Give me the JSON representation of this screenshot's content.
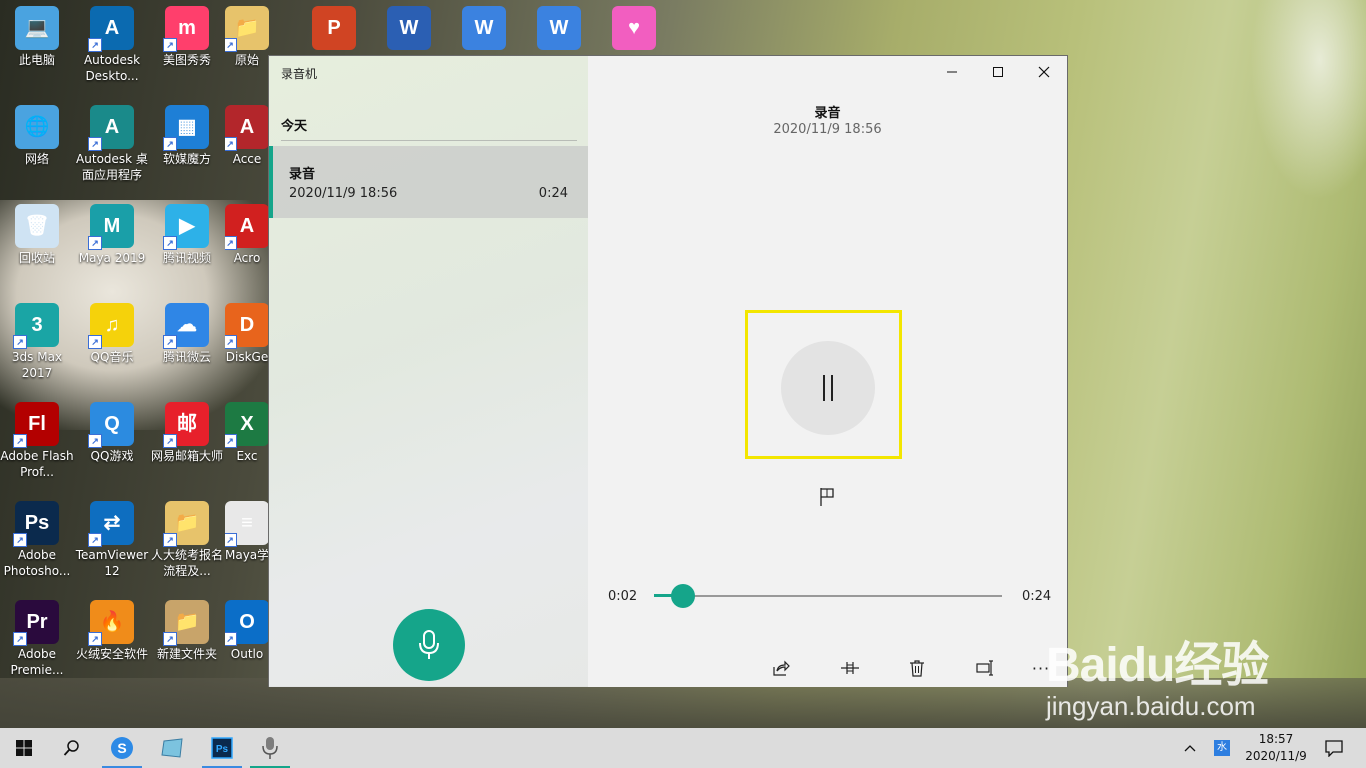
{
  "desktop": {
    "icons": [
      {
        "label": "此电脑",
        "glyph": "💻",
        "color": "#4aa3e0"
      },
      {
        "label": "Autodesk Deskto...",
        "glyph": "A",
        "color": "#0b6ab0"
      },
      {
        "label": "美图秀秀",
        "glyph": "m",
        "color": "#ff3f6c"
      },
      {
        "label": "原始",
        "glyph": "📁",
        "color": "#e7c36b"
      },
      {
        "label": "网络",
        "glyph": "🌐",
        "color": "#4aa3e0"
      },
      {
        "label": "Autodesk 桌面应用程序",
        "glyph": "A",
        "color": "#1a8a8a"
      },
      {
        "label": "软媒魔方",
        "glyph": "▦",
        "color": "#1e7fd6"
      },
      {
        "label": "Acce",
        "glyph": "A",
        "color": "#b3262b"
      },
      {
        "label": "回收站",
        "glyph": "🗑",
        "color": "#cfe3f3"
      },
      {
        "label": "Maya 2019",
        "glyph": "M",
        "color": "#1a9fa8"
      },
      {
        "label": "腾讯视频",
        "glyph": "▶",
        "color": "#2db1e8"
      },
      {
        "label": "Acro",
        "glyph": "A",
        "color": "#d1201f"
      },
      {
        "label": "3ds Max 2017",
        "glyph": "3",
        "color": "#1aa5a5"
      },
      {
        "label": "QQ音乐",
        "glyph": "♫",
        "color": "#f5d20b"
      },
      {
        "label": "腾讯微云",
        "glyph": "☁",
        "color": "#2f86e6"
      },
      {
        "label": "DiskGe",
        "glyph": "D",
        "color": "#e8641c"
      },
      {
        "label": "Adobe Flash Prof...",
        "glyph": "Fl",
        "color": "#b30000"
      },
      {
        "label": "QQ游戏",
        "glyph": "Q",
        "color": "#2c8be0"
      },
      {
        "label": "网易邮箱大师",
        "glyph": "邮",
        "color": "#e7202b"
      },
      {
        "label": "Exc",
        "glyph": "X",
        "color": "#1d7a43"
      },
      {
        "label": "Adobe Photosho...",
        "glyph": "Ps",
        "color": "#0b2a4d"
      },
      {
        "label": "TeamViewer 12",
        "glyph": "⇄",
        "color": "#0e6ec0"
      },
      {
        "label": "人大统考报名流程及...",
        "glyph": "📁",
        "color": "#e7c36b"
      },
      {
        "label": "Maya学源.t",
        "glyph": "≡",
        "color": "#e8e8e8"
      },
      {
        "label": "Adobe Premie...",
        "glyph": "Pr",
        "color": "#2a0a3d"
      },
      {
        "label": "火绒安全软件",
        "glyph": "🔥",
        "color": "#f08c1a"
      },
      {
        "label": "新建文件夹",
        "glyph": "📁",
        "color": "#c8a46a"
      },
      {
        "label": "Outlo",
        "glyph": "O",
        "color": "#0b6ec8"
      }
    ],
    "top_icons": [
      {
        "glyph": "P",
        "color": "#d04423"
      },
      {
        "glyph": "W",
        "color": "#2b5fb3"
      },
      {
        "glyph": "W",
        "color": "#3b82e0"
      },
      {
        "glyph": "W",
        "color": "#3b82e0"
      },
      {
        "glyph": "♥",
        "color": "#f25ec0"
      }
    ]
  },
  "app": {
    "title": "录音机",
    "group_header": "今天",
    "recording": {
      "name": "录音",
      "date": "2020/11/9 18:56",
      "duration": "0:24"
    },
    "player": {
      "title": "录音",
      "date": "2020/11/9 18:56",
      "current_time": "0:02",
      "total_time": "0:24",
      "progress": 0.083
    },
    "accent_color": "#15a58a",
    "highlight_color": "#f3e600"
  },
  "taskbar": {
    "time": "18:57",
    "date": "2020/11/9",
    "ime_label": "水"
  },
  "watermark": {
    "brand": "Baidu经验",
    "url": "jingyan.baidu.com"
  }
}
